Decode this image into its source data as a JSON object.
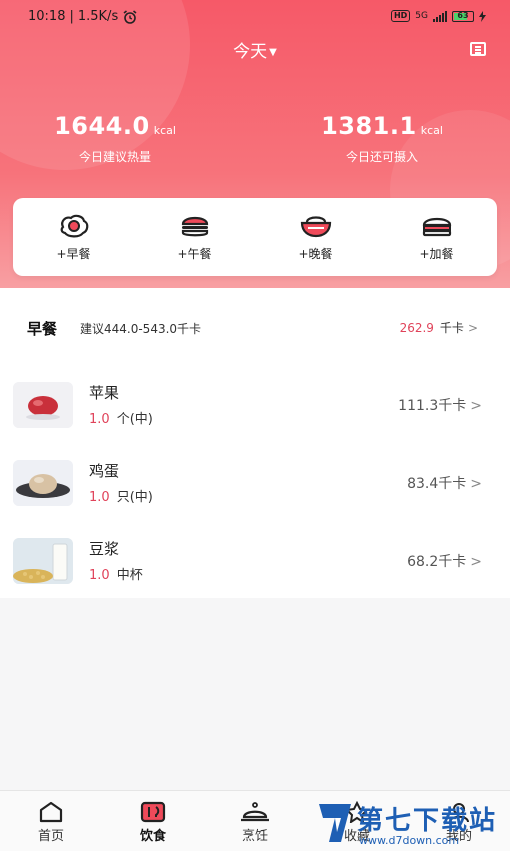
{
  "status_bar": {
    "time": "10:18",
    "net_speed": "1.5K/s",
    "hd": "HD",
    "network": "5G",
    "battery": "63"
  },
  "header": {
    "date": "今天",
    "recommended": {
      "value": "1644.0",
      "unit": "kcal",
      "label": "今日建议热量"
    },
    "remaining": {
      "value": "1381.1",
      "unit": "kcal",
      "label": "今日还可摄入"
    }
  },
  "meal_buttons": [
    {
      "label": "+早餐",
      "icon": "fried-egg-icon"
    },
    {
      "label": "+午餐",
      "icon": "burger-icon"
    },
    {
      "label": "+晚餐",
      "icon": "rice-bowl-icon"
    },
    {
      "label": "+加餐",
      "icon": "sandwich-icon"
    }
  ],
  "breakfast": {
    "title": "早餐",
    "suggestion": "建议444.0-543.0千卡",
    "total_value": "262.9",
    "total_unit": "千卡",
    "items": [
      {
        "name": "苹果",
        "qty": "1.0",
        "unit": "个(中)",
        "kcal": "111.3千卡"
      },
      {
        "name": "鸡蛋",
        "qty": "1.0",
        "unit": "只(中)",
        "kcal": "83.4千卡"
      },
      {
        "name": "豆浆",
        "qty": "1.0",
        "unit": "中杯",
        "kcal": "68.2千卡"
      }
    ]
  },
  "tabs": [
    {
      "label": "首页",
      "icon": "home-icon"
    },
    {
      "label": "饮食",
      "icon": "diet-icon"
    },
    {
      "label": "烹饪",
      "icon": "cloche-icon"
    },
    {
      "label": "收藏",
      "icon": "star-icon"
    },
    {
      "label": "我的",
      "icon": "profile-icon"
    }
  ],
  "watermark": {
    "text": "第七下载站",
    "url": "www.d7down.com"
  },
  "colors": {
    "accent": "#f65968",
    "highlight": "#e0435a",
    "watermark": "#1e5fb4"
  }
}
